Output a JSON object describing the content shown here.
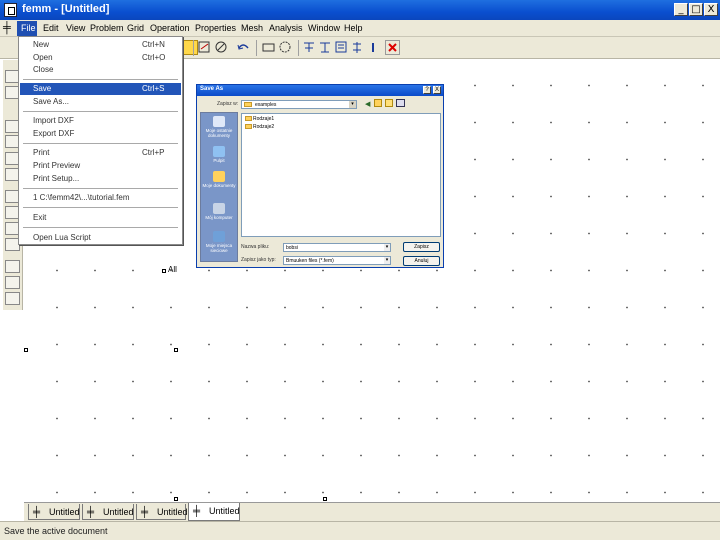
{
  "window": {
    "title": "femm - [Untitled]",
    "min_symbol": "_",
    "max_symbol": "□",
    "close_symbol": "X",
    "mdi_min_symbol": "_",
    "mdi_restore_symbol": "▫",
    "mdi_close_symbol": "x"
  },
  "menubar": {
    "items": [
      "File",
      "Edit",
      "View",
      "Problem",
      "Grid",
      "Operation",
      "Properties",
      "Mesh",
      "Analysis",
      "Window",
      "Help"
    ]
  },
  "file_menu": {
    "new": {
      "label": "New",
      "shortcut": "Ctrl+N"
    },
    "open": {
      "label": "Open",
      "shortcut": "Ctrl+O"
    },
    "close": {
      "label": "Close"
    },
    "save": {
      "label": "Save",
      "shortcut": "Ctrl+S"
    },
    "save_as": {
      "label": "Save As..."
    },
    "import_dxf": {
      "label": "Import DXF"
    },
    "export_dxf": {
      "label": "Export DXF"
    },
    "print": {
      "label": "Print",
      "shortcut": "Ctrl+P"
    },
    "print_preview": {
      "label": "Print Preview"
    },
    "print_setup": {
      "label": "Print Setup..."
    },
    "recent": {
      "label": "1 C:\\femm42\\...\\tutorial.fem"
    },
    "exit": {
      "label": "Exit"
    },
    "open_lua": {
      "label": "Open Lua Script"
    }
  },
  "dialog": {
    "title": "Save As",
    "help_symbol": "?",
    "close_symbol": "X",
    "save_in_label": "Zapisz w:",
    "save_in_value": "examples",
    "places": [
      "Moje ostatnie dokumenty",
      "Pulpit",
      "Moje dokumenty",
      "Mój komputer",
      "Moje miejsca sieciowe"
    ],
    "files": [
      "Rodzaje1",
      "Rodzaje2"
    ],
    "filename_label": "Nazwa pliku:",
    "filename_value": "bobsi",
    "filetype_label": "Zapisz jako typ:",
    "filetype_value": "Bmuuken files (*.fem)",
    "save_button": "Zapisz",
    "cancel_button": "Anuluj"
  },
  "canvas": {
    "label_text": "All"
  },
  "tabs": [
    "Untitled",
    "Untitled",
    "Untitled",
    "Untitled"
  ],
  "status": {
    "text": "Save the active document"
  },
  "colors": {
    "titlebar": "#0a4fcf",
    "menu_highlight": "#2255b8",
    "chrome": "#ece9d8"
  }
}
